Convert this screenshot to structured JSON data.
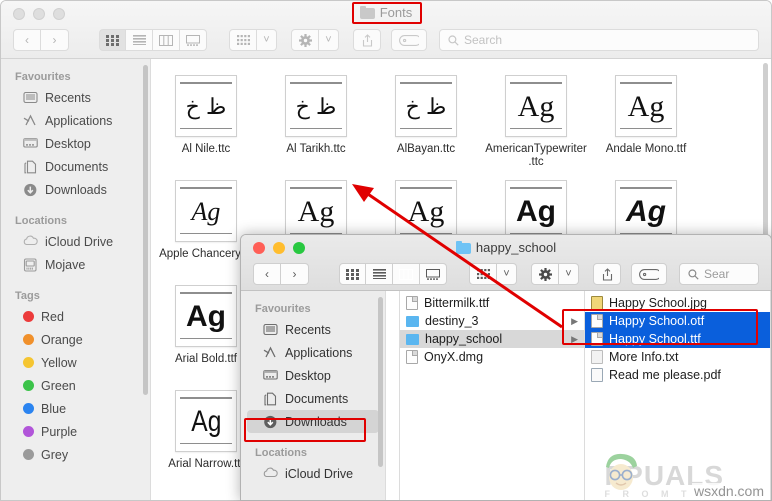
{
  "fonts_window": {
    "title": "Fonts",
    "title_icon": "folder-icon",
    "active": false,
    "traffic_lights": [
      "close-button",
      "minimize-button",
      "maximize-button"
    ],
    "toolbar": {
      "back": "‹",
      "forward": "›",
      "view_icon": "icon-view",
      "view_list": "list-view",
      "view_column": "column-view",
      "view_gallery": "gallery-view",
      "group": "group-by",
      "group_chevron": "˅",
      "action": "⚙",
      "action_chevron": "˅",
      "share": "⤴",
      "tags": "⬭"
    },
    "search": {
      "placeholder": "Search",
      "value": "",
      "icon": "search-icon"
    },
    "sidebar": {
      "sections": [
        {
          "header": "Favourites",
          "items": [
            {
              "label": "Recents",
              "icon": "recents-icon",
              "selected": false
            },
            {
              "label": "Applications",
              "icon": "applications-icon",
              "selected": false
            },
            {
              "label": "Desktop",
              "icon": "desktop-icon",
              "selected": false
            },
            {
              "label": "Documents",
              "icon": "documents-icon",
              "selected": false
            },
            {
              "label": "Downloads",
              "icon": "downloads-icon",
              "selected": false
            }
          ]
        },
        {
          "header": "Locations",
          "items": [
            {
              "label": "iCloud Drive",
              "icon": "icloud-icon",
              "selected": false
            },
            {
              "label": "Mojave",
              "icon": "harddisk-icon",
              "selected": false
            }
          ]
        },
        {
          "header": "Tags",
          "items": [
            {
              "label": "Red",
              "icon": "tag-dot",
              "color": "#ec3b3b"
            },
            {
              "label": "Orange",
              "icon": "tag-dot",
              "color": "#f0902b"
            },
            {
              "label": "Yellow",
              "icon": "tag-dot",
              "color": "#f5c531"
            },
            {
              "label": "Green",
              "icon": "tag-dot",
              "color": "#3cc34a"
            },
            {
              "label": "Blue",
              "icon": "tag-dot",
              "color": "#2b84f0"
            },
            {
              "label": "Purple",
              "icon": "tag-dot",
              "color": "#b155d9"
            },
            {
              "label": "Grey",
              "icon": "tag-dot",
              "color": "#9a9a9a"
            }
          ]
        }
      ]
    },
    "files": [
      {
        "name": "Al Nile.ttc",
        "glyph": "ظ خ",
        "style": "arabic"
      },
      {
        "name": "Al Tarikh.ttc",
        "glyph": "ظ خ",
        "style": "arabic"
      },
      {
        "name": "AlBayan.ttc",
        "glyph": "ظ خ",
        "style": "arabic"
      },
      {
        "name": "AmericanTypewriter.ttc",
        "glyph": "Ag",
        "style": "serif"
      },
      {
        "name": "Andale Mono.ttf",
        "glyph": "Ag",
        "style": "mono"
      },
      {
        "name": "Apple Chancery.ttf",
        "glyph": "Ag",
        "style": "script"
      },
      {
        "name": "",
        "glyph": "Ag",
        "style": "serif"
      },
      {
        "name": "",
        "glyph": "Ag",
        "style": "serif"
      },
      {
        "name": "",
        "glyph": "Ag",
        "style": "sans-bold"
      },
      {
        "name": "",
        "glyph": "Ag",
        "style": "sans-bold-italic"
      },
      {
        "name": "Arial Bold.ttf",
        "glyph": "Ag",
        "style": "sans-bold"
      },
      {
        "name": "Arial Narrow.ttf",
        "glyph": "Ag",
        "style": "sans-narrow"
      }
    ]
  },
  "happy_school_window": {
    "title": "happy_school",
    "title_icon": "folder-icon",
    "active": true,
    "toolbar": {
      "back": "‹",
      "forward": "›",
      "view_icon": "icon-view",
      "view_list": "list-view",
      "view_column": "column-view",
      "view_gallery": "gallery-view",
      "group": "group-by",
      "group_chevron": "˅",
      "action": "⚙",
      "action_chevron": "˅",
      "share": "⤴",
      "tags": "⬭"
    },
    "search": {
      "placeholder": "Sear",
      "value": "",
      "icon": "search-icon"
    },
    "sidebar": {
      "sections": [
        {
          "header": "Favourites",
          "items": [
            {
              "label": "Recents",
              "icon": "recents-icon",
              "selected": false
            },
            {
              "label": "Applications",
              "icon": "applications-icon",
              "selected": false
            },
            {
              "label": "Desktop",
              "icon": "desktop-icon",
              "selected": false
            },
            {
              "label": "Documents",
              "icon": "documents-icon",
              "selected": false
            },
            {
              "label": "Downloads",
              "icon": "downloads-icon",
              "selected": true
            }
          ]
        },
        {
          "header": "Locations",
          "items": [
            {
              "label": "iCloud Drive",
              "icon": "icloud-icon",
              "selected": false
            }
          ]
        }
      ]
    },
    "column_middle": [
      {
        "name": "Bittermilk.ttf",
        "icon": "document-icon",
        "selected": false,
        "has_children": false
      },
      {
        "name": "destiny_3",
        "icon": "folder-icon",
        "selected": false,
        "has_children": true,
        "disclosure": "▶"
      },
      {
        "name": "happy_school",
        "icon": "folder-icon",
        "selected": true,
        "has_children": true,
        "disclosure": "▶"
      },
      {
        "name": "OnyX.dmg",
        "icon": "document-icon",
        "selected": false,
        "has_children": false
      }
    ],
    "column_right": [
      {
        "name": "Happy School.jpg",
        "icon": "image-icon",
        "selected": false
      },
      {
        "name": "Happy School.otf",
        "icon": "font-document-icon",
        "selected": true
      },
      {
        "name": "Happy School.ttf",
        "icon": "font-document-icon",
        "selected": true
      },
      {
        "name": "More Info.txt",
        "icon": "text-document-icon",
        "selected": false
      },
      {
        "name": "Read me please.pdf",
        "icon": "pdf-document-icon",
        "selected": false
      }
    ]
  },
  "annotations": {
    "highlight_title": "Fonts",
    "highlight_downloads": "Downloads",
    "highlight_selected_fonts": "Happy School.otf / Happy School.ttf",
    "arrow": "drag-arrow-from-selection-to-fonts-folder",
    "accent_color": "#e00000",
    "selection_color": "#0a5fdc"
  },
  "watermark": {
    "brand": "PPUALS",
    "tagline": "F R O M   T H E   E X",
    "overlay": "wsxdn.com"
  }
}
